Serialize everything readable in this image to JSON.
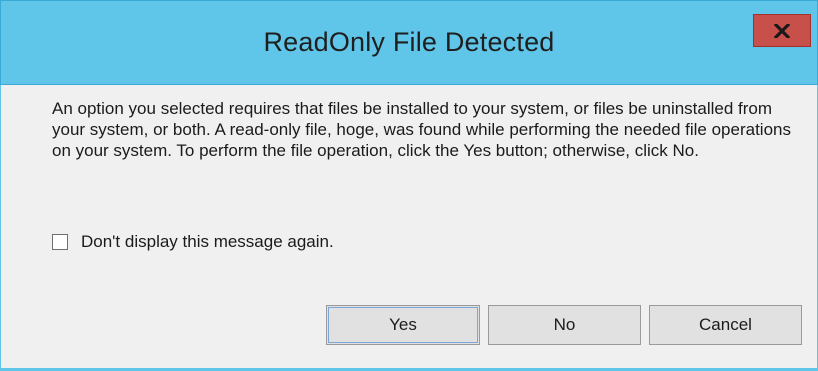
{
  "window": {
    "title": "ReadOnly File Detected",
    "close_icon": "close-x-icon",
    "close_icon_glyph": "x"
  },
  "message": {
    "text": "An option you selected requires that files be installed to your system, or files be uninstalled from your system, or both. A read-only file, hoge, was found while performing the needed file operations on your system. To perform the file operation, click the Yes button; otherwise, click No."
  },
  "checkbox": {
    "label": "Don't display this message again.",
    "checked": false
  },
  "buttons": {
    "yes": "Yes",
    "no": "No",
    "cancel": "Cancel"
  },
  "colors": {
    "titlebar": "#5fc6e9",
    "close_button": "#c7504a",
    "background": "#f0f0f0",
    "button_face": "#e1e1e1"
  }
}
